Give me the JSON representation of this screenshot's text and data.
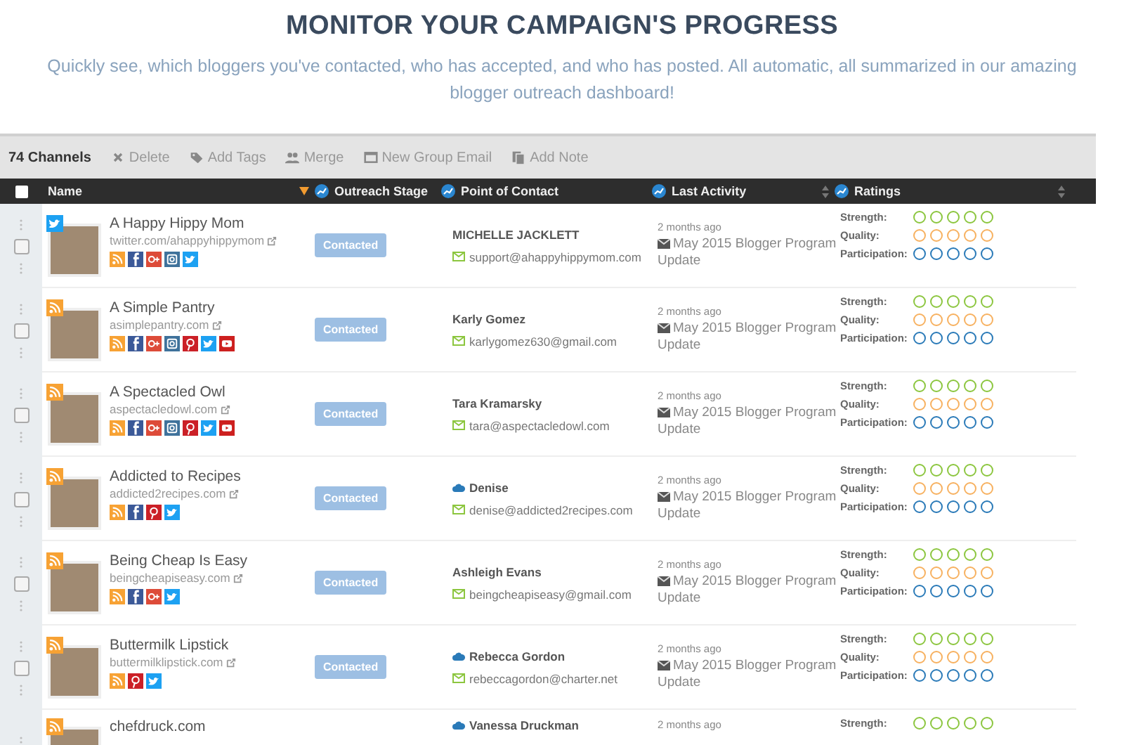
{
  "header": {
    "title": "MONITOR YOUR CAMPAIGN'S PROGRESS",
    "subtitle": "Quickly see, which bloggers you've contacted, who has accepted, and who has posted.  All automatic, all summarized in our amazing blogger outreach dashboard!"
  },
  "toolbar": {
    "count": "74 Channels",
    "actions": [
      {
        "label": "Delete"
      },
      {
        "label": "Add Tags"
      },
      {
        "label": "Merge"
      },
      {
        "label": "New Group Email"
      },
      {
        "label": "Add Note"
      }
    ]
  },
  "table": {
    "header_checked": false,
    "columns": [
      {
        "label": "Name"
      },
      {
        "label": "Outreach Stage"
      },
      {
        "label": "Point of Contact"
      },
      {
        "label": "Last Activity"
      },
      {
        "label": "Ratings"
      }
    ],
    "rows": [
      {
        "checked": false,
        "badge": {
          "kind": "twitter"
        },
        "name": "A Happy Hippy Mom",
        "url": "twitter.com/ahappyhippymom",
        "networks": [
          {
            "kind": "rss"
          },
          {
            "kind": "facebook"
          },
          {
            "kind": "googleplus"
          },
          {
            "kind": "instagram"
          },
          {
            "kind": "twitter"
          }
        ],
        "stage": "Contacted",
        "contact": {
          "name": "MICHELLE JACKLETT",
          "email": "support@ahappyhippymom.com",
          "cloud": false
        },
        "activity": {
          "time": "2 months ago",
          "title": "May 2015 Blogger Program Update"
        },
        "ratings": [
          {
            "label": "Strength:",
            "stars": 0,
            "color": "#8cc63f"
          },
          {
            "label": "Quality:",
            "stars": 0,
            "color": "#f7b160"
          },
          {
            "label": "Participation:",
            "stars": 0,
            "color": "#2a7ab8"
          }
        ]
      },
      {
        "checked": false,
        "badge": {
          "kind": "rss"
        },
        "name": "A Simple Pantry",
        "url": "asimplepantry.com",
        "networks": [
          {
            "kind": "rss"
          },
          {
            "kind": "facebook"
          },
          {
            "kind": "googleplus"
          },
          {
            "kind": "instagram"
          },
          {
            "kind": "pinterest"
          },
          {
            "kind": "twitter"
          },
          {
            "kind": "youtube"
          }
        ],
        "stage": "Contacted",
        "contact": {
          "name": "Karly Gomez",
          "email": "karlygomez630@gmail.com",
          "cloud": false
        },
        "activity": {
          "time": "2 months ago",
          "title": "May 2015 Blogger Program Update"
        },
        "ratings": [
          {
            "label": "Strength:",
            "stars": 0,
            "color": "#8cc63f"
          },
          {
            "label": "Quality:",
            "stars": 0,
            "color": "#f7b160"
          },
          {
            "label": "Participation:",
            "stars": 0,
            "color": "#2a7ab8"
          }
        ]
      },
      {
        "checked": false,
        "badge": {
          "kind": "rss"
        },
        "name": "A Spectacled Owl",
        "url": "aspectacledowl.com",
        "networks": [
          {
            "kind": "rss"
          },
          {
            "kind": "facebook"
          },
          {
            "kind": "googleplus"
          },
          {
            "kind": "instagram"
          },
          {
            "kind": "pinterest"
          },
          {
            "kind": "twitter"
          },
          {
            "kind": "youtube"
          }
        ],
        "stage": "Contacted",
        "contact": {
          "name": "Tara Kramarsky",
          "email": "tara@aspectacledowl.com",
          "cloud": false
        },
        "activity": {
          "time": "2 months ago",
          "title": "May 2015 Blogger Program Update"
        },
        "ratings": [
          {
            "label": "Strength:",
            "stars": 0,
            "color": "#8cc63f"
          },
          {
            "label": "Quality:",
            "stars": 0,
            "color": "#f7b160"
          },
          {
            "label": "Participation:",
            "stars": 0,
            "color": "#2a7ab8"
          }
        ]
      },
      {
        "checked": false,
        "badge": {
          "kind": "rss"
        },
        "name": "Addicted to Recipes",
        "url": "addicted2recipes.com",
        "networks": [
          {
            "kind": "rss"
          },
          {
            "kind": "facebook"
          },
          {
            "kind": "pinterest"
          },
          {
            "kind": "twitter"
          }
        ],
        "stage": "Contacted",
        "contact": {
          "name": "Denise",
          "email": "denise@addicted2recipes.com",
          "cloud": true
        },
        "activity": {
          "time": "2 months ago",
          "title": "May 2015 Blogger Program Update"
        },
        "ratings": [
          {
            "label": "Strength:",
            "stars": 0,
            "color": "#8cc63f"
          },
          {
            "label": "Quality:",
            "stars": 0,
            "color": "#f7b160"
          },
          {
            "label": "Participation:",
            "stars": 0,
            "color": "#2a7ab8"
          }
        ]
      },
      {
        "checked": false,
        "badge": {
          "kind": "rss"
        },
        "name": "Being Cheap Is Easy",
        "url": "beingcheapiseasy.com",
        "networks": [
          {
            "kind": "rss"
          },
          {
            "kind": "facebook"
          },
          {
            "kind": "googleplus"
          },
          {
            "kind": "twitter"
          }
        ],
        "stage": "Contacted",
        "contact": {
          "name": "Ashleigh Evans",
          "email": "beingcheapiseasy@gmail.com",
          "cloud": false
        },
        "activity": {
          "time": "2 months ago",
          "title": "May 2015 Blogger Program Update"
        },
        "ratings": [
          {
            "label": "Strength:",
            "stars": 0,
            "color": "#8cc63f"
          },
          {
            "label": "Quality:",
            "stars": 0,
            "color": "#f7b160"
          },
          {
            "label": "Participation:",
            "stars": 0,
            "color": "#2a7ab8"
          }
        ]
      },
      {
        "checked": false,
        "badge": {
          "kind": "rss"
        },
        "name": "Buttermilk Lipstick",
        "url": "buttermilklipstick.com",
        "networks": [
          {
            "kind": "rss"
          },
          {
            "kind": "pinterest"
          },
          {
            "kind": "twitter"
          }
        ],
        "stage": "Contacted",
        "contact": {
          "name": "Rebecca Gordon",
          "email": "rebeccagordon@charter.net",
          "cloud": true
        },
        "activity": {
          "time": "2 months ago",
          "title": "May 2015 Blogger Program Update"
        },
        "ratings": [
          {
            "label": "Strength:",
            "stars": 0,
            "color": "#8cc63f"
          },
          {
            "label": "Quality:",
            "stars": 0,
            "color": "#f7b160"
          },
          {
            "label": "Participation:",
            "stars": 0,
            "color": "#2a7ab8"
          }
        ]
      },
      {
        "badge": {
          "kind": "rss"
        },
        "name": "chefdruck.com",
        "contact": {
          "name": "Vanessa Druckman",
          "cloud": true
        },
        "activity": {
          "time": "2 months ago"
        },
        "ratings": [
          {
            "label": "Strength:",
            "stars": 0,
            "color": "#8cc63f"
          }
        ]
      }
    ]
  }
}
